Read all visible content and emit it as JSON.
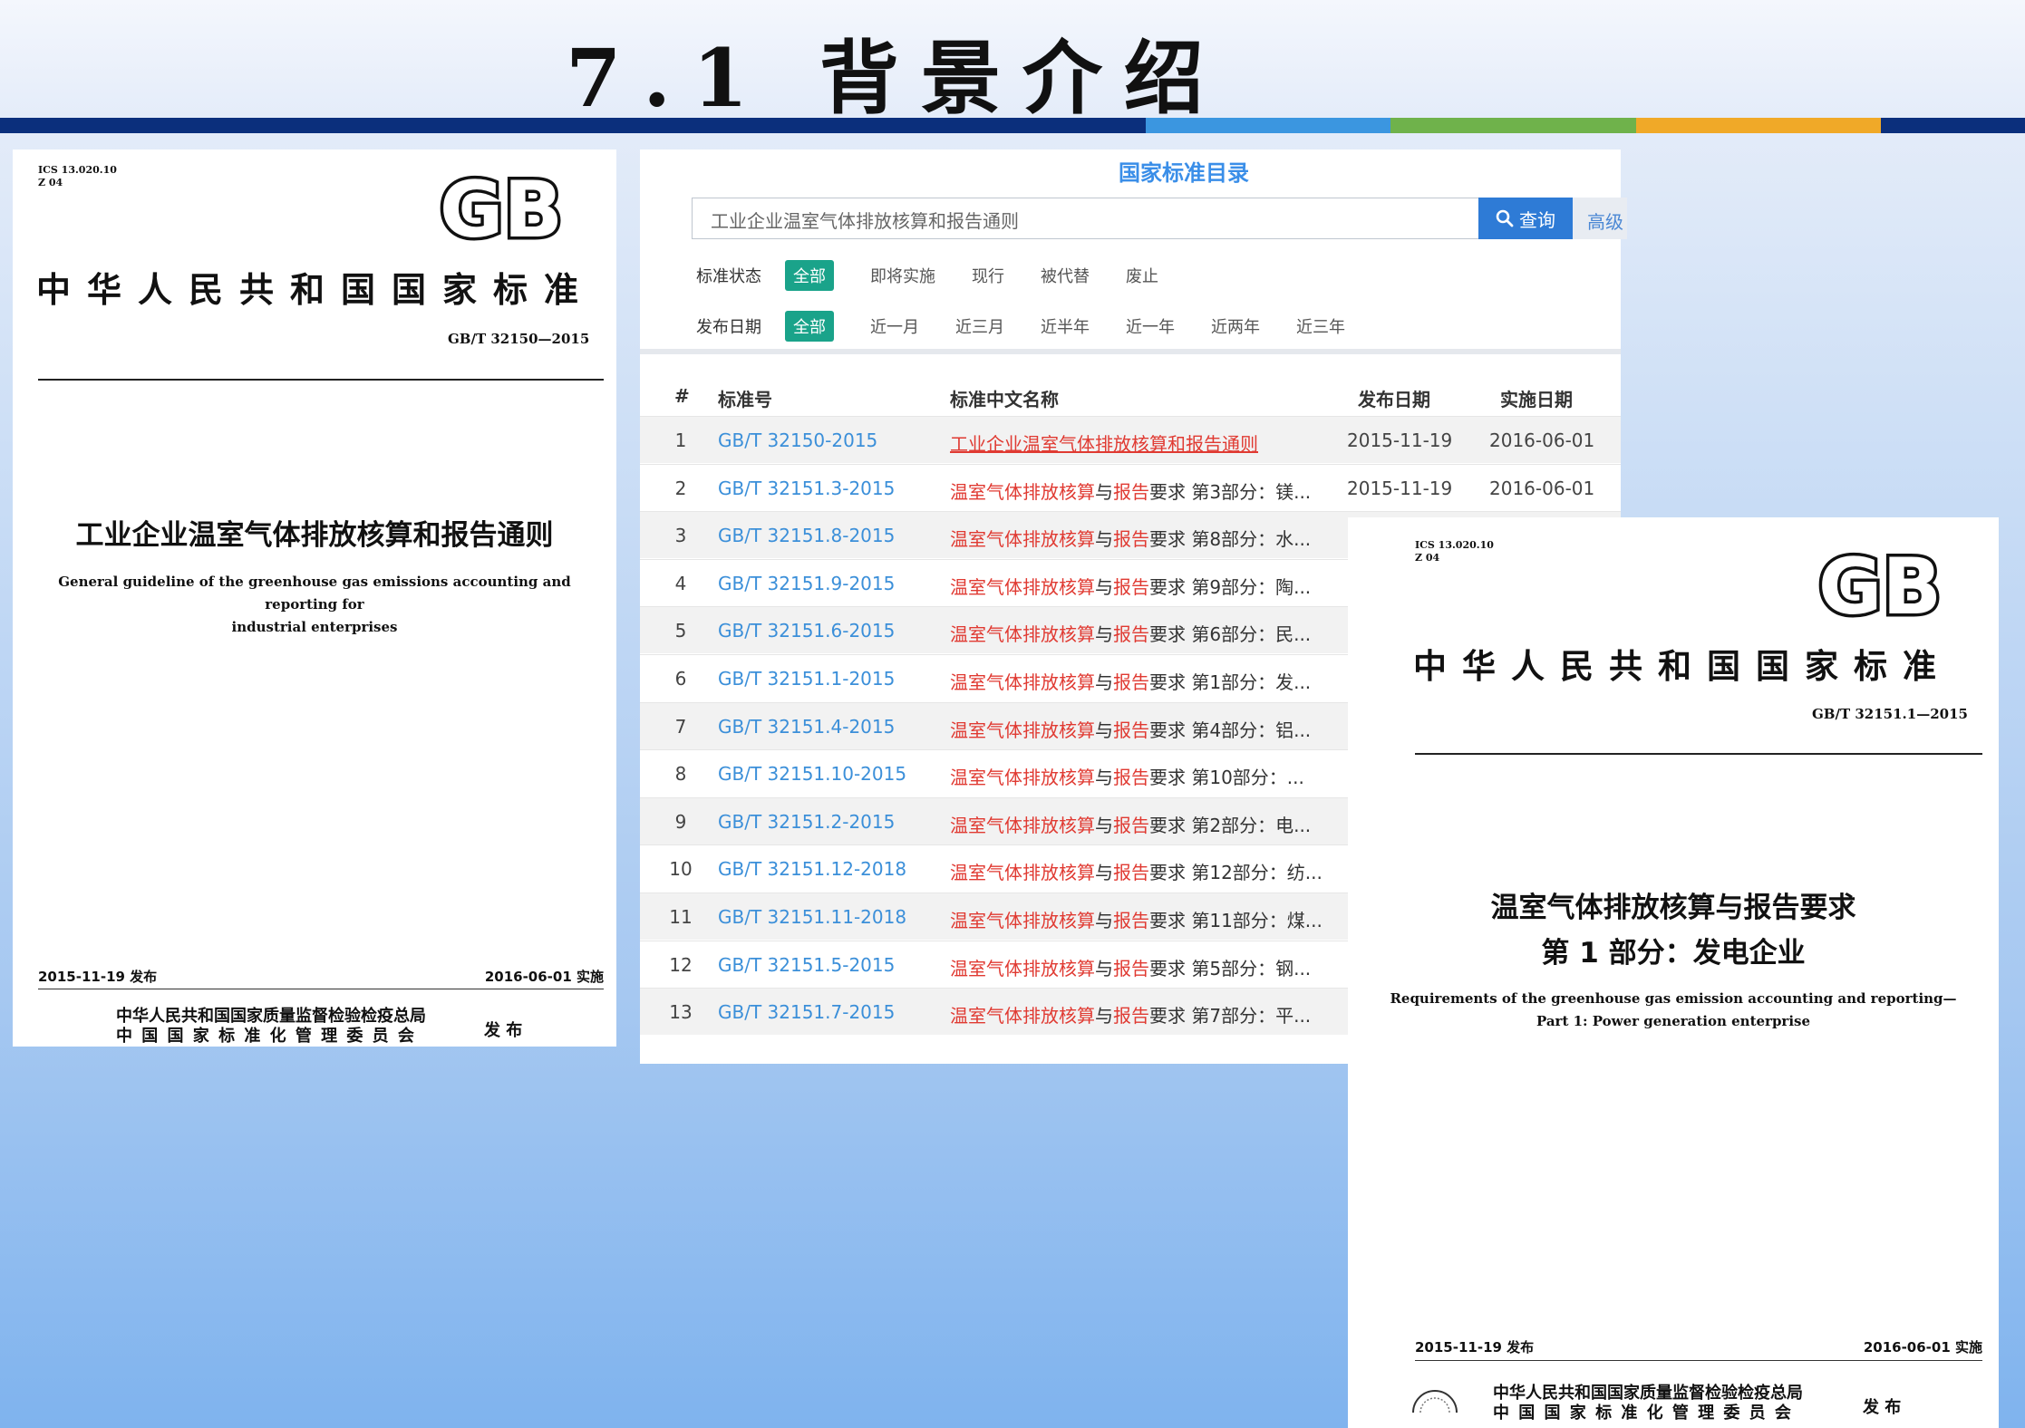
{
  "slide": {
    "title": "7.1 背景介绍",
    "colors": {
      "navy": "#0b2f7c",
      "blue": "#3b96e0",
      "green": "#6fb24b",
      "orange": "#f0a928"
    }
  },
  "doc_left": {
    "ics": "ICS 13.020.10",
    "ccs": "Z 04",
    "logo": "GB",
    "national_title": "中华人民共和国国家标准",
    "code": "GB/T 32150—2015",
    "title_cn": "工业企业温室气体排放核算和报告通则",
    "title_en_1": "General guideline of the greenhouse gas emissions accounting and reporting for",
    "title_en_2": "industrial enterprises",
    "publish_date": "2015-11-19 发布",
    "implement_date": "2016-06-01 实施",
    "issuer_1": "中华人民共和国国家质量监督检验检疫总局",
    "issuer_2": "中 国 国 家 标 准 化 管 理 委 员 会",
    "issue_word": "发 布"
  },
  "catalog": {
    "title": "国家标准目录",
    "search": {
      "value": "工业企业温室气体排放核算和报告通则",
      "button": "查询",
      "advanced": "高级"
    },
    "status_filter": {
      "label": "标准状态",
      "options": [
        "全部",
        "即将实施",
        "现行",
        "被代替",
        "废止"
      ],
      "active": "全部"
    },
    "date_filter": {
      "label": "发布日期",
      "options": [
        "全部",
        "近一月",
        "近三月",
        "近半年",
        "近一年",
        "近两年",
        "近三年"
      ],
      "active": "全部"
    },
    "columns": [
      "#",
      "标准号",
      "标准中文名称",
      "发布日期",
      "实施日期"
    ],
    "rows": [
      {
        "num": "1",
        "code": "GB/T 32150-2015",
        "name": "工业企业温室气体排放核算和报告通则",
        "pub": "2015-11-19",
        "imp": "2016-06-01"
      },
      {
        "num": "2",
        "code": "GB/T 32151.3-2015",
        "name": "温室气体排放核算与报告要求 第3部分：镁...",
        "pub": "2015-11-19",
        "imp": "2016-06-01"
      },
      {
        "num": "3",
        "code": "GB/T 32151.8-2015",
        "name": "温室气体排放核算与报告要求 第8部分：水..."
      },
      {
        "num": "4",
        "code": "GB/T 32151.9-2015",
        "name": "温室气体排放核算与报告要求 第9部分：陶..."
      },
      {
        "num": "5",
        "code": "GB/T 32151.6-2015",
        "name": "温室气体排放核算与报告要求 第6部分：民..."
      },
      {
        "num": "6",
        "code": "GB/T 32151.1-2015",
        "name": "温室气体排放核算与报告要求 第1部分：发..."
      },
      {
        "num": "7",
        "code": "GB/T 32151.4-2015",
        "name": "温室气体排放核算与报告要求 第4部分：铝..."
      },
      {
        "num": "8",
        "code": "GB/T 32151.10-2015",
        "name": "温室气体排放核算与报告要求 第10部分：..."
      },
      {
        "num": "9",
        "code": "GB/T 32151.2-2015",
        "name": "温室气体排放核算与报告要求 第2部分：电..."
      },
      {
        "num": "10",
        "code": "GB/T 32151.12-2018",
        "name": "温室气体排放核算与报告要求 第12部分：纺..."
      },
      {
        "num": "11",
        "code": "GB/T 32151.11-2018",
        "name": "温室气体排放核算与报告要求 第11部分：煤..."
      },
      {
        "num": "12",
        "code": "GB/T 32151.5-2015",
        "name": "温室气体排放核算与报告要求 第5部分：钢..."
      },
      {
        "num": "13",
        "code": "GB/T 32151.7-2015",
        "name": "温室气体排放核算与报告要求 第7部分：平..."
      }
    ]
  },
  "doc_right": {
    "ics": "ICS 13.020.10",
    "ccs": "Z 04",
    "logo": "GB",
    "national_title": "中华人民共和国国家标准",
    "code": "GB/T 32151.1—2015",
    "title_cn_1": "温室气体排放核算与报告要求",
    "title_cn_2": "第 1 部分：发电企业",
    "title_en_1": "Requirements of the greenhouse gas emission accounting and reporting—",
    "title_en_2": "Part 1: Power generation enterprise",
    "publish_date": "2015-11-19 发布",
    "implement_date": "2016-06-01 实施",
    "issuer_1": "中华人民共和国国家质量监督检验检疫总局",
    "issuer_2": "中 国 国 家 标 准 化 管 理 委 员 会",
    "issue_word": "发 布"
  }
}
